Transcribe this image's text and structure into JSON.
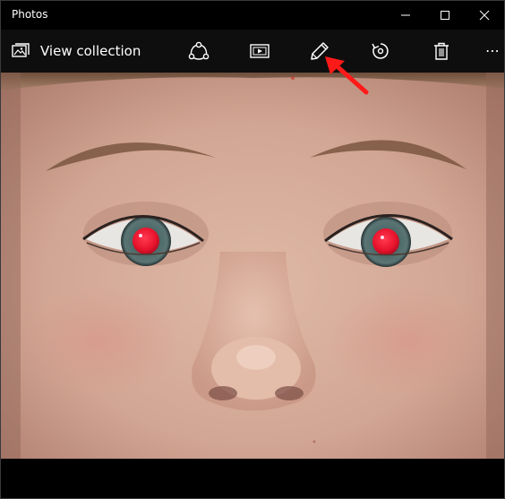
{
  "window": {
    "title": "Photos"
  },
  "toolbar": {
    "view_collection_label": "View collection",
    "icons": [
      "photos-icon",
      "share-icon",
      "slideshow-icon",
      "edit-pencil-icon",
      "rotate-icon",
      "delete-icon",
      "more-icon"
    ]
  },
  "colors": {
    "background": "#000000",
    "toolbar": "#0e0e0e",
    "icon": "#ffffff",
    "annotation_arrow": "#ff1a1a",
    "red_eye": "#e8132c"
  }
}
